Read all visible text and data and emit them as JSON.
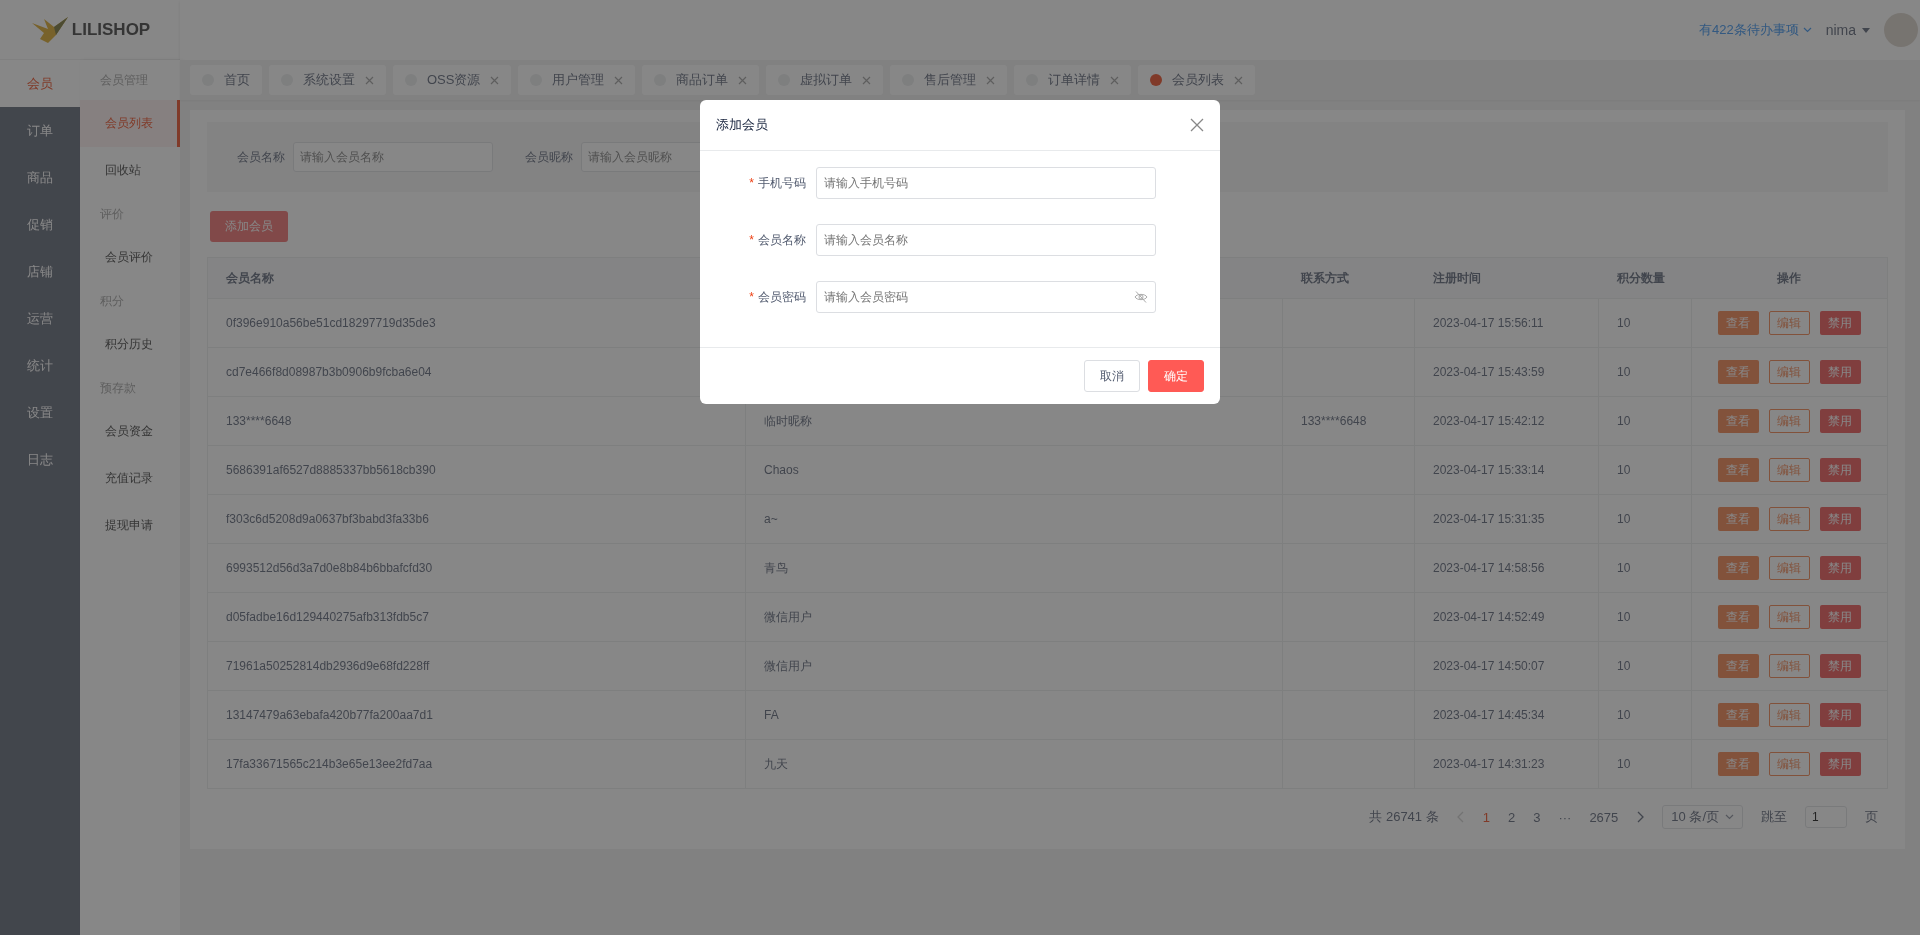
{
  "logo": {
    "text": "LILISHOP"
  },
  "header": {
    "todo_link": "有422条待办事项",
    "user": "nima"
  },
  "main_nav": [
    {
      "label": "会员",
      "selected": true
    },
    {
      "label": "订单",
      "selected": false
    },
    {
      "label": "商品",
      "selected": false
    },
    {
      "label": "促销",
      "selected": false
    },
    {
      "label": "店铺",
      "selected": false
    },
    {
      "label": "运营",
      "selected": false
    },
    {
      "label": "统计",
      "selected": false
    },
    {
      "label": "设置",
      "selected": false
    },
    {
      "label": "日志",
      "selected": false
    }
  ],
  "sub_nav": [
    {
      "group": "会员管理",
      "items": [
        {
          "label": "会员列表",
          "selected": true
        },
        {
          "label": "回收站",
          "selected": false
        }
      ]
    },
    {
      "group": "评价",
      "items": [
        {
          "label": "会员评价",
          "selected": false
        }
      ]
    },
    {
      "group": "积分",
      "items": [
        {
          "label": "积分历史",
          "selected": false
        }
      ]
    },
    {
      "group": "预存款",
      "items": [
        {
          "label": "会员资金",
          "selected": false
        },
        {
          "label": "充值记录",
          "selected": false
        },
        {
          "label": "提现申请",
          "selected": false
        }
      ]
    }
  ],
  "tabs": [
    {
      "label": "首页",
      "selected": false,
      "closable": false
    },
    {
      "label": "系统设置",
      "selected": false,
      "closable": true
    },
    {
      "label": "OSS资源",
      "selected": false,
      "closable": true
    },
    {
      "label": "用户管理",
      "selected": false,
      "closable": true
    },
    {
      "label": "商品订单",
      "selected": false,
      "closable": true
    },
    {
      "label": "虚拟订单",
      "selected": false,
      "closable": true
    },
    {
      "label": "售后管理",
      "selected": false,
      "closable": true
    },
    {
      "label": "订单详情",
      "selected": false,
      "closable": true
    },
    {
      "label": "会员列表",
      "selected": true,
      "closable": true
    }
  ],
  "search": [
    {
      "label": "会员名称",
      "placeholder": "请输入会员名称"
    },
    {
      "label": "会员昵称",
      "placeholder": "请输入会员昵称"
    }
  ],
  "add_button": "添加会员",
  "table": {
    "columns": [
      "会员名称",
      null,
      "联系方式",
      "注册时间",
      "积分数量",
      "操作"
    ],
    "rows": [
      {
        "name": "0f396e910a56be51cd18297719d35de3",
        "time": "2023-04-17 15:56:11",
        "points": "10",
        "actions": [
          {
            "kind": "view",
            "label": "查看"
          },
          {
            "kind": "edit",
            "label": "编辑"
          },
          {
            "kind": "disable",
            "label": "禁用"
          }
        ]
      },
      {
        "name": "cd7e466f8d08987b3b0906b9fcba6e04",
        "time": "2023-04-17 15:43:59",
        "points": "10",
        "actions": [
          {
            "kind": "view",
            "label": "查看"
          },
          {
            "kind": "edit",
            "label": "编辑"
          },
          {
            "kind": "disable",
            "label": "禁用"
          }
        ]
      },
      {
        "name": "133****6648",
        "nickname": "临时昵称",
        "contact": "133****6648",
        "time": "2023-04-17 15:42:12",
        "points": "10",
        "actions": [
          {
            "kind": "view",
            "label": "查看"
          },
          {
            "kind": "edit",
            "label": "编辑"
          },
          {
            "kind": "disable",
            "label": "禁用"
          }
        ]
      },
      {
        "name": "5686391af6527d8885337bb5618cb390",
        "nickname": "Chaos",
        "time": "2023-04-17 15:33:14",
        "points": "10",
        "actions": [
          {
            "kind": "view",
            "label": "查看"
          },
          {
            "kind": "edit",
            "label": "编辑"
          },
          {
            "kind": "disable",
            "label": "禁用"
          }
        ]
      },
      {
        "name": "f303c6d5208d9a0637bf3babd3fa33b6",
        "nickname": "a~",
        "time": "2023-04-17 15:31:35",
        "points": "10",
        "actions": [
          {
            "kind": "view",
            "label": "查看"
          },
          {
            "kind": "edit",
            "label": "编辑"
          },
          {
            "kind": "disable",
            "label": "禁用"
          }
        ]
      },
      {
        "name": "6993512d56d3a7d0e8b84b6bbafcfd30",
        "nickname": "青鸟",
        "time": "2023-04-17 14:58:56",
        "points": "10",
        "actions": [
          {
            "kind": "view",
            "label": "查看"
          },
          {
            "kind": "edit",
            "label": "编辑"
          },
          {
            "kind": "disable",
            "label": "禁用"
          }
        ]
      },
      {
        "name": "d05fadbe16d129440275afb313fdb5c7",
        "nickname": "微信用户",
        "time": "2023-04-17 14:52:49",
        "points": "10",
        "actions": [
          {
            "kind": "view",
            "label": "查看"
          },
          {
            "kind": "edit",
            "label": "编辑"
          },
          {
            "kind": "disable",
            "label": "禁用"
          }
        ]
      },
      {
        "name": "71961a50252814db2936d9e68fd228ff",
        "nickname": "微信用户",
        "time": "2023-04-17 14:50:07",
        "points": "10",
        "actions": [
          {
            "kind": "view",
            "label": "查看"
          },
          {
            "kind": "edit",
            "label": "编辑"
          },
          {
            "kind": "disable",
            "label": "禁用"
          }
        ]
      },
      {
        "name": "13147479a63ebafa420b77fa200aa7d1",
        "nickname": "FA",
        "time": "2023-04-17 14:45:34",
        "points": "10",
        "actions": [
          {
            "kind": "view",
            "label": "查看"
          },
          {
            "kind": "edit",
            "label": "编辑"
          },
          {
            "kind": "disable",
            "label": "禁用"
          }
        ]
      },
      {
        "name": "17fa33671565c214b3e65e13ee2fd7aa",
        "nickname": "九天",
        "time": "2023-04-17 14:31:23",
        "points": "10",
        "actions": [
          {
            "kind": "view",
            "label": "查看"
          },
          {
            "kind": "edit",
            "label": "编辑"
          },
          {
            "kind": "disable",
            "label": "禁用"
          }
        ]
      }
    ]
  },
  "pagination": {
    "total": "共 26741 条",
    "pages": [
      {
        "label": "1",
        "selected": true
      },
      {
        "label": "2",
        "selected": false
      },
      {
        "label": "3",
        "selected": false
      },
      {
        "label": "···",
        "selected": false
      },
      {
        "label": "2675",
        "selected": false
      }
    ],
    "page_size": "10 条/页",
    "jump_label": "跳至",
    "jump_value": "1",
    "page_suffix": "页"
  },
  "modal": {
    "title": "添加会员",
    "fields": [
      {
        "label": "手机号码",
        "placeholder": "请输入手机号码",
        "required_mark": "*",
        "kind": "text"
      },
      {
        "label": "会员名称",
        "placeholder": "请输入会员名称",
        "required_mark": "*",
        "kind": "text"
      },
      {
        "label": "会员密码",
        "placeholder": "请输入会员密码",
        "required_mark": "*",
        "kind": "password"
      }
    ],
    "cancel": "取消",
    "confirm": "确定"
  }
}
